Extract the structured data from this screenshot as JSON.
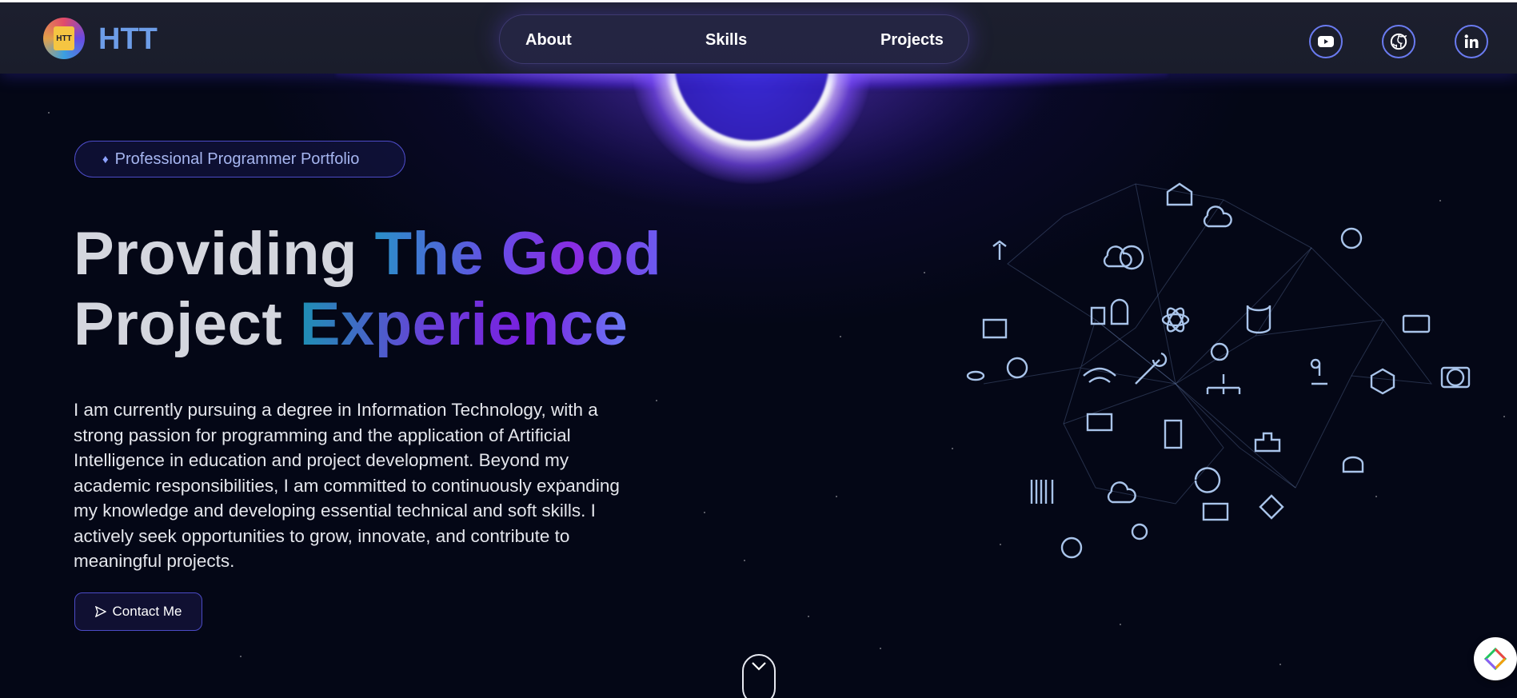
{
  "header": {
    "brand": "HTT",
    "logo_text": "HTT",
    "nav": [
      {
        "label": "About"
      },
      {
        "label": "Skills"
      },
      {
        "label": "Projects"
      }
    ],
    "social": [
      {
        "icon": "youtube-icon"
      },
      {
        "icon": "github-icon"
      },
      {
        "icon": "linkedin-icon"
      }
    ]
  },
  "hero": {
    "badge": "Professional Programmer Portfolio",
    "title_line1_plain": "Providing ",
    "title_line1_accent": "The Good",
    "title_line2_plain": "Project ",
    "title_line2_accent": "Experience",
    "description": "I am currently pursuing a degree in Information Technology, with a strong passion for programming and the application of Artificial Intelligence in education and project development. Beyond my academic responsibilities, I am committed to continuously expanding my knowledge and developing essential technical and soft skills. I actively seek opportunities to grow, innovate, and contribute to meaningful projects.",
    "contact_button": "Contact Me"
  },
  "colors": {
    "accent": "#6a7bf0",
    "brand": "#6d9de8",
    "background": "#050818"
  }
}
